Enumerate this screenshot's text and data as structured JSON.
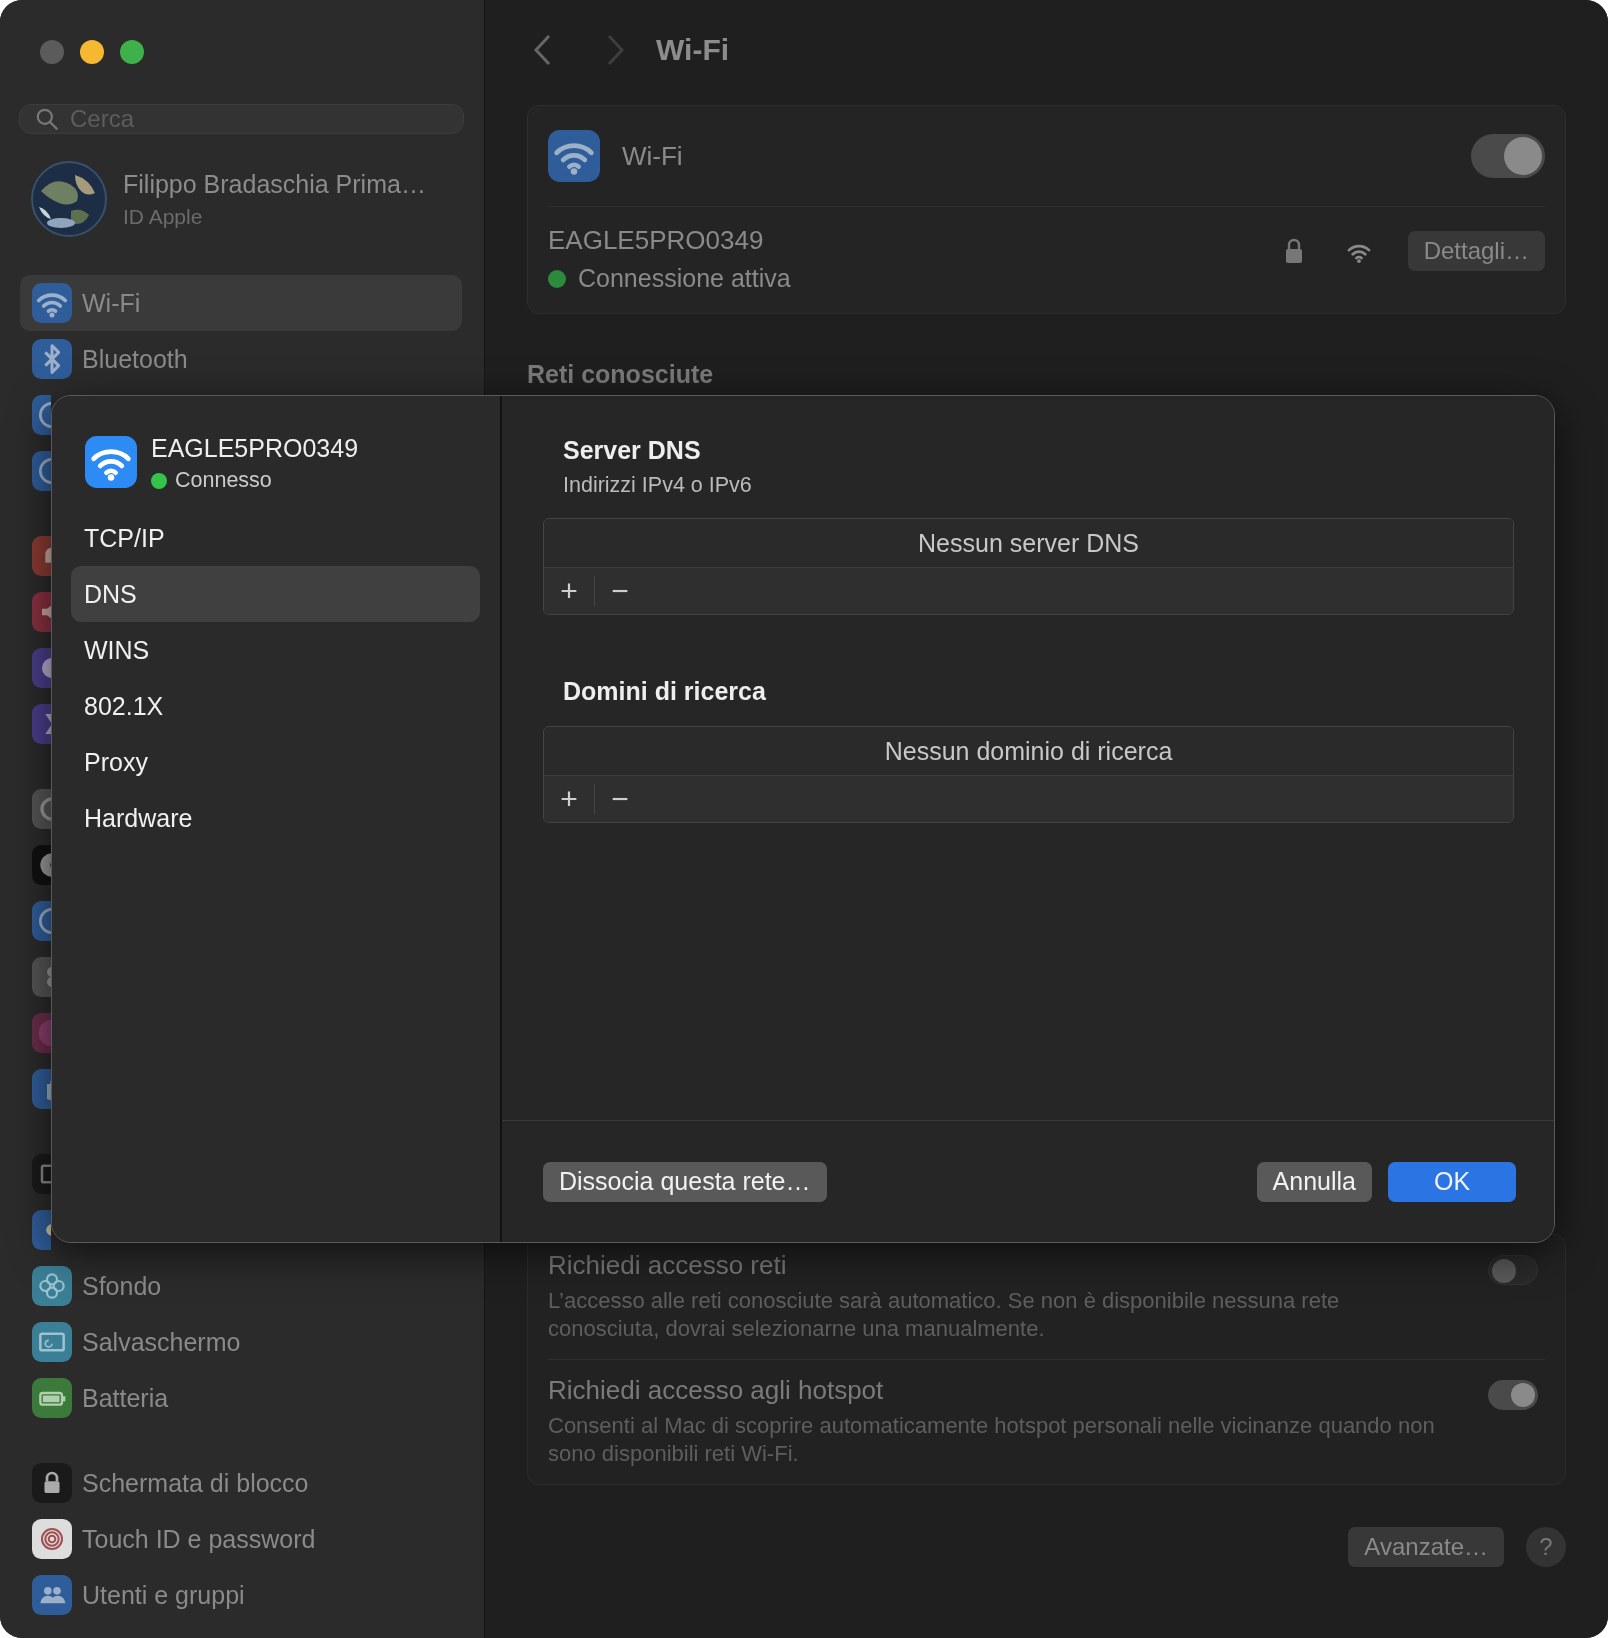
{
  "sidebar": {
    "search": {
      "placeholder": "Cerca"
    },
    "account": {
      "name": "Filippo Bradaschia Prima…",
      "subtitle": "ID Apple"
    },
    "groups": [
      {
        "items": [
          {
            "kind": "wifi",
            "label": "Wi-Fi",
            "selected": true
          },
          {
            "kind": "bluetooth",
            "label": "Bluetooth",
            "selected": false
          },
          {
            "kind": "globe",
            "selected": false
          },
          {
            "kind": "globe",
            "selected": false
          }
        ]
      },
      {
        "items": [
          {
            "kind": "bell",
            "selected": false
          },
          {
            "kind": "sound",
            "selected": false
          },
          {
            "kind": "moon",
            "selected": false
          },
          {
            "kind": "hourglass",
            "selected": false
          }
        ]
      },
      {
        "items": [
          {
            "kind": "gear",
            "selected": false
          },
          {
            "kind": "appearance",
            "selected": false
          },
          {
            "kind": "accessibility",
            "selected": false
          },
          {
            "kind": "switches",
            "selected": false
          },
          {
            "kind": "siri",
            "selected": false
          },
          {
            "kind": "hand",
            "selected": false
          }
        ]
      },
      {
        "items": [
          {
            "kind": "desktop",
            "selected": false
          },
          {
            "kind": "sun",
            "selected": false
          },
          {
            "kind": "flower",
            "label": "Sfondo",
            "selected": false
          },
          {
            "kind": "screen",
            "label": "Salvaschermo",
            "selected": false
          },
          {
            "kind": "battery",
            "label": "Batteria",
            "selected": false
          }
        ]
      },
      {
        "items": [
          {
            "kind": "lock",
            "label": "Schermata di blocco",
            "selected": false
          },
          {
            "kind": "fingerprint",
            "label": "Touch ID e password",
            "selected": false
          },
          {
            "kind": "people",
            "label": "Utenti e gruppi",
            "selected": false
          }
        ]
      }
    ]
  },
  "main": {
    "title": "Wi-Fi",
    "wifi": {
      "label": "Wi-Fi",
      "on": true
    },
    "network": {
      "name": "EAGLE5PRO0349",
      "status": "Connessione attiva",
      "button": "Dettagli…"
    },
    "known_heading": "Reti conosciute",
    "options": [
      {
        "title": "Richiedi accesso reti",
        "description": "L’accesso alle reti conosciute sarà automatico. Se non è disponibile nessuna rete conosciuta, dovrai selezionarne una manualmente.",
        "on": false
      },
      {
        "title": "Richiedi accesso agli hotspot",
        "description": "Consenti al Mac di scoprire automaticamente hotspot personali nelle vicinanze quando non sono disponibili reti Wi-Fi.",
        "on": true
      }
    ],
    "advanced_button": "Avanzate…",
    "help_button": "?"
  },
  "dialog": {
    "network": "EAGLE5PRO0349",
    "status": "Connesso",
    "tabs": [
      {
        "label": "TCP/IP",
        "selected": false
      },
      {
        "label": "DNS",
        "selected": true
      },
      {
        "label": "WINS",
        "selected": false
      },
      {
        "label": "802.1X",
        "selected": false
      },
      {
        "label": "Proxy",
        "selected": false
      },
      {
        "label": "Hardware",
        "selected": false
      }
    ],
    "sections": [
      {
        "title": "Server DNS",
        "subtitle": "Indirizzi IPv4 o IPv6",
        "empty": "Nessun server DNS",
        "add": "+",
        "remove": "−"
      },
      {
        "title": "Domini di ricerca",
        "empty": "Nessun dominio di ricerca",
        "add": "+",
        "remove": "−"
      }
    ],
    "buttons": [
      {
        "label": "Dissocia questa rete…",
        "kind": "secondary"
      },
      {
        "label": "Annulla",
        "kind": "secondary"
      },
      {
        "label": "OK",
        "kind": "primary"
      }
    ]
  }
}
